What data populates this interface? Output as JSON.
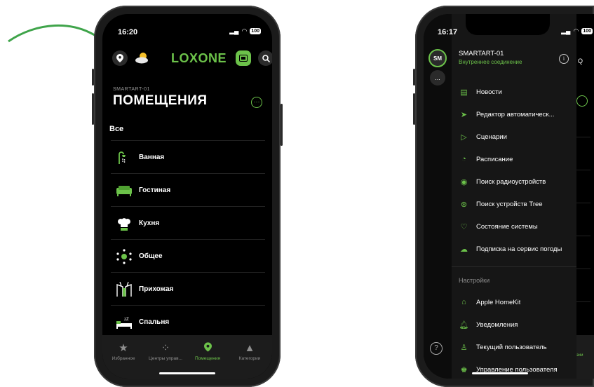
{
  "phone1": {
    "time": "16:20",
    "battery": "100",
    "logo": "LOXONE",
    "location_icon": "location-pin-icon",
    "weather_icon": "sun-cloud-icon",
    "subtitle": "SMARTART-01",
    "title": "ПОМЕЩЕНИЯ",
    "all_label": "Все",
    "rooms": [
      {
        "label": "Ванная",
        "icon": "shower-icon"
      },
      {
        "label": "Гостиная",
        "icon": "sofa-icon"
      },
      {
        "label": "Кухня",
        "icon": "chef-hat-icon"
      },
      {
        "label": "Общее",
        "icon": "network-icon"
      },
      {
        "label": "Прихожая",
        "icon": "hallway-icon"
      },
      {
        "label": "Спальня",
        "icon": "bed-icon"
      }
    ],
    "tabs": [
      {
        "label": "Избранное",
        "icon": "star-icon",
        "active": false
      },
      {
        "label": "Центры управ...",
        "icon": "control-center-icon",
        "active": false
      },
      {
        "label": "Помещения",
        "icon": "location-pin-icon",
        "active": true
      },
      {
        "label": "Категории",
        "icon": "categories-icon",
        "active": false
      }
    ]
  },
  "phone2": {
    "time": "16:17",
    "battery": "100",
    "avatar": "SM",
    "more": "...",
    "server_name": "SMARTART-01",
    "connection": "Внутреннее соединение",
    "menu": [
      {
        "label": "Новости",
        "icon": "news-icon"
      },
      {
        "label": "Редактор автоматическ...",
        "icon": "send-icon"
      },
      {
        "label": "Сценарии",
        "icon": "play-icon"
      },
      {
        "label": "Расписание",
        "icon": "clock-icon"
      },
      {
        "label": "Поиск радиоустройств",
        "icon": "radio-icon"
      },
      {
        "label": "Поиск устройств Tree",
        "icon": "tree-icon"
      },
      {
        "label": "Состояние системы",
        "icon": "heart-pulse-icon"
      },
      {
        "label": "Подписка на сервис погоды",
        "icon": "weather-icon"
      }
    ],
    "settings_label": "Настройки",
    "settings": [
      {
        "label": "Apple HomeKit",
        "icon": "homekit-icon"
      },
      {
        "label": "Уведомления",
        "icon": "bell-icon"
      },
      {
        "label": "Текущий пользователь",
        "icon": "user-icon"
      },
      {
        "label": "Управление пользователя",
        "icon": "users-icon"
      }
    ],
    "help": "?",
    "peek_label": "зии"
  },
  "colors": {
    "accent": "#6cc24a",
    "background": "#000000",
    "drawer": "#161616"
  }
}
